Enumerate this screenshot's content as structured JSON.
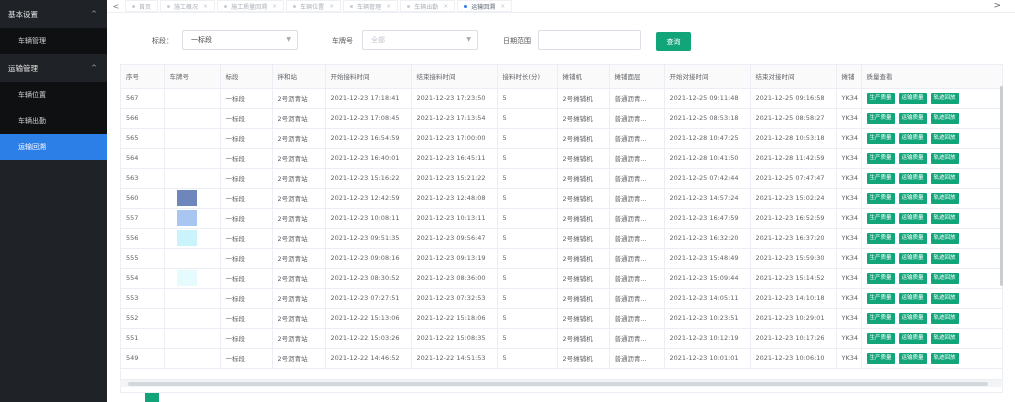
{
  "sidebar": {
    "groups": [
      {
        "label": "基本设置",
        "chevron": "^",
        "items": [
          "车辆管理"
        ]
      },
      {
        "label": "运输管理",
        "chevron": "^",
        "items": [
          "车辆位置",
          "车辆出勤",
          "运输回溯"
        ]
      }
    ],
    "active_item": "运输回溯"
  },
  "tabs": {
    "items": [
      "首页",
      "施工概况",
      "施工质量回溯",
      "车辆位置",
      "车辆管理",
      "车辆出勤",
      "运输回溯"
    ],
    "active": "运输回溯",
    "close_glyph": "×",
    "prev_glyph": "<",
    "next_glyph": ">"
  },
  "filters": {
    "section_label": "标段：",
    "section_value": "一标段",
    "plate_label": "车牌号",
    "plate_placeholder": "全部",
    "date_label": "日期范围",
    "query_label": "查询"
  },
  "table": {
    "columns": [
      "序号",
      "车牌号",
      "标段",
      "拌和站",
      "开始接料时间",
      "结束接料时间",
      "接料时长(分)",
      "摊铺机",
      "摊铺面层",
      "开始对接时间",
      "结束对接时间",
      "摊铺",
      "质量查看"
    ],
    "row_buttons": [
      "生产质量",
      "运输质量",
      "轨迹回放"
    ],
    "rows": [
      [
        "567",
        "",
        "一标段",
        "2号沥青站",
        "2021-12-23 17:18:41",
        "2021-12-23 17:23:50",
        "5",
        "2号摊铺机",
        "普通沥青...",
        "2021-12-25 09:11:48",
        "2021-12-25 09:16:58",
        "YK34"
      ],
      [
        "566",
        "",
        "一标段",
        "2号沥青站",
        "2021-12-23 17:08:45",
        "2021-12-23 17:13:54",
        "5",
        "2号摊铺机",
        "普通沥青...",
        "2021-12-25 08:53:18",
        "2021-12-25 08:58:27",
        "YK34"
      ],
      [
        "565",
        "",
        "一标段",
        "2号沥青站",
        "2021-12-23 16:54:59",
        "2021-12-23 17:00:00",
        "5",
        "2号摊铺机",
        "普通沥青...",
        "2021-12-28 10:47:25",
        "2021-12-28 10:53:18",
        "YK34"
      ],
      [
        "564",
        "",
        "一标段",
        "2号沥青站",
        "2021-12-23 16:40:01",
        "2021-12-23 16:45:11",
        "5",
        "2号摊铺机",
        "普通沥青...",
        "2021-12-28 10:41:50",
        "2021-12-28 11:42:59",
        "YK34"
      ],
      [
        "563",
        "",
        "一标段",
        "2号沥青站",
        "2021-12-23 15:16:22",
        "2021-12-23 15:21:22",
        "5",
        "2号摊铺机",
        "普通沥青...",
        "2021-12-25 07:42:44",
        "2021-12-25 07:47:47",
        "YK34"
      ],
      [
        "560",
        "",
        "一标段",
        "2号沥青站",
        "2021-12-23 12:42:59",
        "2021-12-23 12:48:08",
        "5",
        "2号摊铺机",
        "普通沥青...",
        "2021-12-23 14:57:24",
        "2021-12-23 15:02:24",
        "YK34"
      ],
      [
        "557",
        "",
        "一标段",
        "2号沥青站",
        "2021-12-23 10:08:11",
        "2021-12-23 10:13:11",
        "5",
        "2号摊铺机",
        "普通沥青...",
        "2021-12-23 16:47:59",
        "2021-12-23 16:52:59",
        "YK34"
      ],
      [
        "556",
        "",
        "一标段",
        "2号沥青站",
        "2021-12-23 09:51:35",
        "2021-12-23 09:56:47",
        "5",
        "2号摊铺机",
        "普通沥青...",
        "2021-12-23 16:32:20",
        "2021-12-23 16:37:20",
        "YK34"
      ],
      [
        "555",
        "",
        "一标段",
        "2号沥青站",
        "2021-12-23 09:08:16",
        "2021-12-23 09:13:19",
        "5",
        "2号摊铺机",
        "普通沥青...",
        "2021-12-23 15:48:49",
        "2021-12-23 15:59:30",
        "YK34"
      ],
      [
        "554",
        "",
        "一标段",
        "2号沥青站",
        "2021-12-23 08:30:52",
        "2021-12-23 08:36:00",
        "5",
        "2号摊铺机",
        "普通沥青...",
        "2021-12-23 15:09:44",
        "2021-12-23 15:14:52",
        "YK34"
      ],
      [
        "553",
        "",
        "一标段",
        "2号沥青站",
        "2021-12-23 07:27:51",
        "2021-12-23 07:32:53",
        "5",
        "2号摊铺机",
        "普通沥青...",
        "2021-12-23 14:05:11",
        "2021-12-23 14:10:18",
        "YK34"
      ],
      [
        "552",
        "",
        "一标段",
        "2号沥青站",
        "2021-12-22 15:13:06",
        "2021-12-22 15:18:06",
        "5",
        "2号摊铺机",
        "普通沥青...",
        "2021-12-23 10:23:51",
        "2021-12-23 10:29:01",
        "YK34"
      ],
      [
        "551",
        "",
        "一标段",
        "2号沥青站",
        "2021-12-22 15:03:26",
        "2021-12-22 15:08:35",
        "5",
        "2号摊铺机",
        "普通沥青...",
        "2021-12-23 10:12:19",
        "2021-12-23 10:17:26",
        "YK34"
      ],
      [
        "549",
        "",
        "一标段",
        "2号沥青站",
        "2021-12-22 14:46:52",
        "2021-12-22 14:51:53",
        "5",
        "2号摊铺机",
        "普通沥青...",
        "2021-12-23 10:01:01",
        "2021-12-23 10:06:10",
        "YK34"
      ]
    ]
  },
  "colors": {
    "accent_green": "#13a57a",
    "active_blue": "#2d7fe8",
    "sidebar_bg": "#1f2226"
  }
}
